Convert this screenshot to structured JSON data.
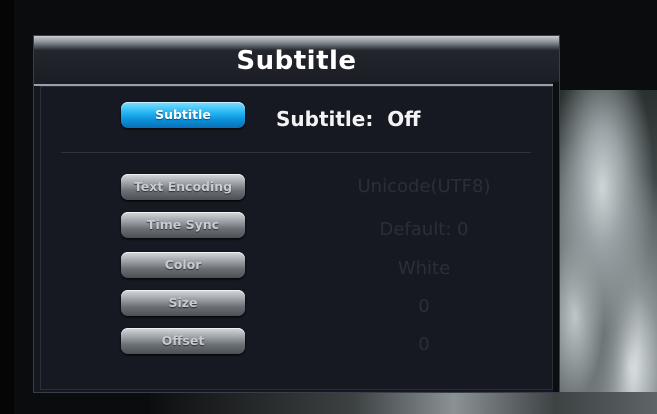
{
  "menu": {
    "title": "Subtitle",
    "subtitle_button": "Subtitle",
    "status_label": "Subtitle:",
    "status_value": "Off",
    "settings": [
      {
        "label": "Text Encoding",
        "value": "Unicode(UTF8)"
      },
      {
        "label": "Time Sync",
        "value": "Default: 0"
      },
      {
        "label": "Color",
        "value": "White"
      },
      {
        "label": "Size",
        "value": "0"
      },
      {
        "label": "Offset",
        "value": "0"
      }
    ]
  },
  "colors": {
    "active_button": "#27b6f3",
    "inactive_button": "#9ea3a8",
    "panel": "#161922",
    "disabled_value": "#2a2f37",
    "title_text": "#ffffff"
  }
}
